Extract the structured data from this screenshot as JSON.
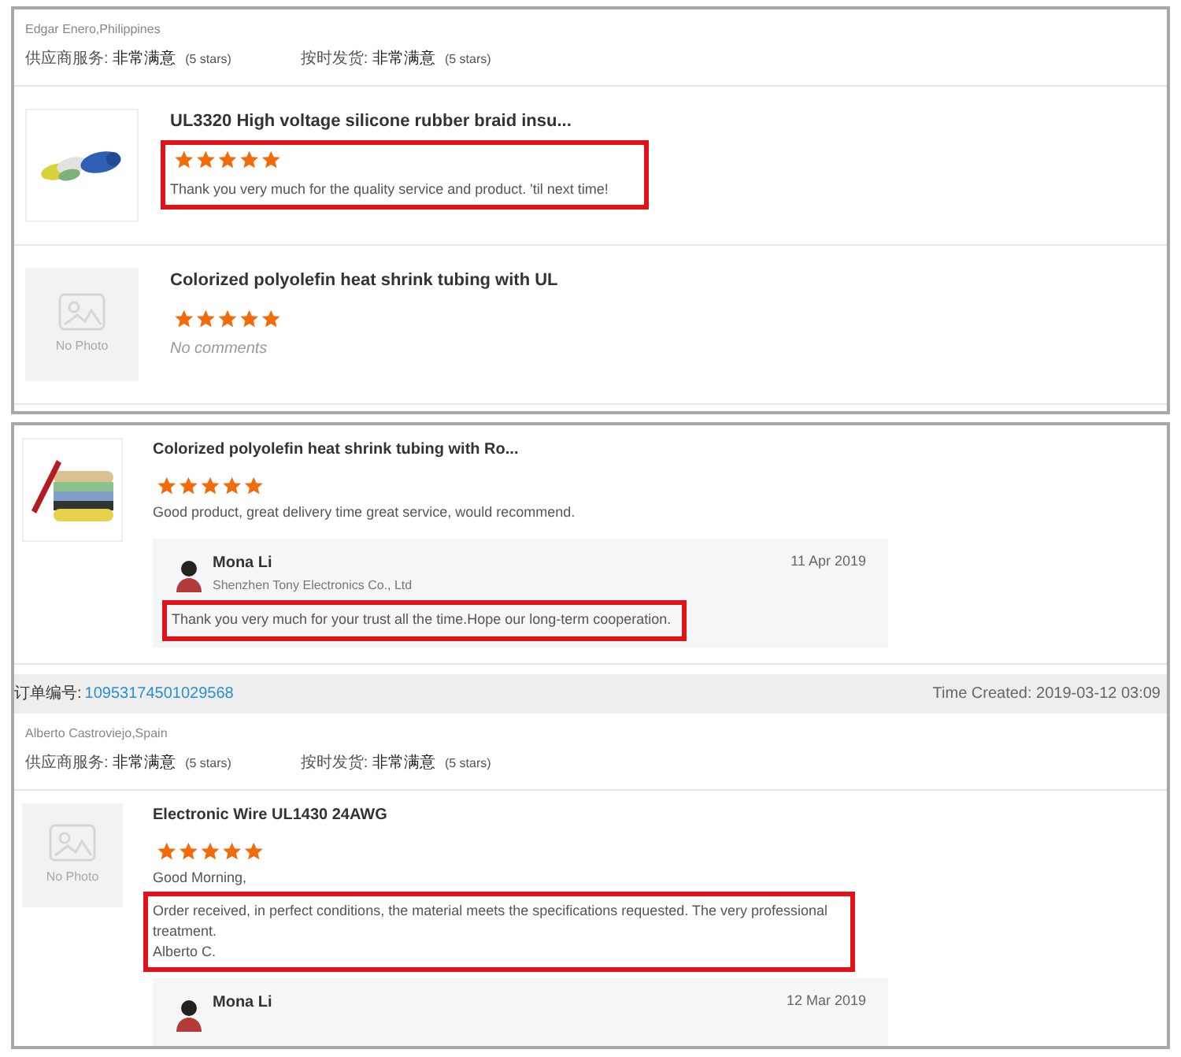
{
  "panels": [
    {
      "blocks": [
        {
          "kind": "buyer",
          "customer": "Edgar Enero,Philippines",
          "ratings": [
            {
              "label": "供应商服务:",
              "value": "非常满意",
              "note": "(5 stars)"
            },
            {
              "label": "按时发货:",
              "value": "非常满意",
              "note": "(5 stars)"
            }
          ]
        },
        {
          "kind": "product",
          "title": "UL3320 High voltage silicone rubber braid insu...",
          "stars": 5,
          "highlighted": true,
          "comment": [
            {
              "kind": "text",
              "text": "Thank you very much for the quality service and product. 'til next time!"
            }
          ]
        },
        {
          "kind": "product",
          "placeholder_text": "No Photo",
          "title": "Colorized polyolefin heat shrink tubing with UL",
          "stars": 5,
          "comment": [
            {
              "kind": "empty",
              "text": "No comments"
            }
          ]
        }
      ]
    },
    {
      "blocks": [
        {
          "kind": "product",
          "title": "Colorized polyolefin heat shrink tubing with Ro...",
          "stars": 5,
          "comment": [
            {
              "kind": "text",
              "text": "Good product, great delivery time great service, would recommend."
            }
          ],
          "reply": {
            "name": "Mona Li",
            "company": "Shenzhen Tony Electronics Co., Ltd",
            "date": "11 Apr 2019",
            "text": "Thank you very much for your trust all the time.Hope our long-term cooperation.",
            "highlighted": true
          }
        },
        {
          "kind": "order",
          "label": "订单编号:",
          "number": "10953174501029568",
          "time": "Time Created: 2019-03-12 03:09"
        },
        {
          "kind": "buyer",
          "customer": "Alberto Castroviejo,Spain",
          "ratings": [
            {
              "label": "供应商服务:",
              "value": "非常满意",
              "note": "(5 stars)"
            },
            {
              "label": "按时发货:",
              "value": "非常满意",
              "note": "(5 stars)"
            }
          ]
        },
        {
          "kind": "product",
          "placeholder_text": "No Photo",
          "title": "Electronic Wire UL1430 24AWG",
          "stars": 5,
          "comment": [
            {
              "kind": "text",
              "text": "Good Morning,"
            },
            {
              "kind": "text",
              "text": "Order received, in perfect conditions, the material meets the specifications requested. The very professional treatment.",
              "highlighted": true
            },
            {
              "kind": "text",
              "text": "Alberto C.",
              "highlighted": true
            }
          ],
          "reply": {
            "name": "Mona Li",
            "date": "12 Mar 2019"
          }
        }
      ]
    }
  ]
}
